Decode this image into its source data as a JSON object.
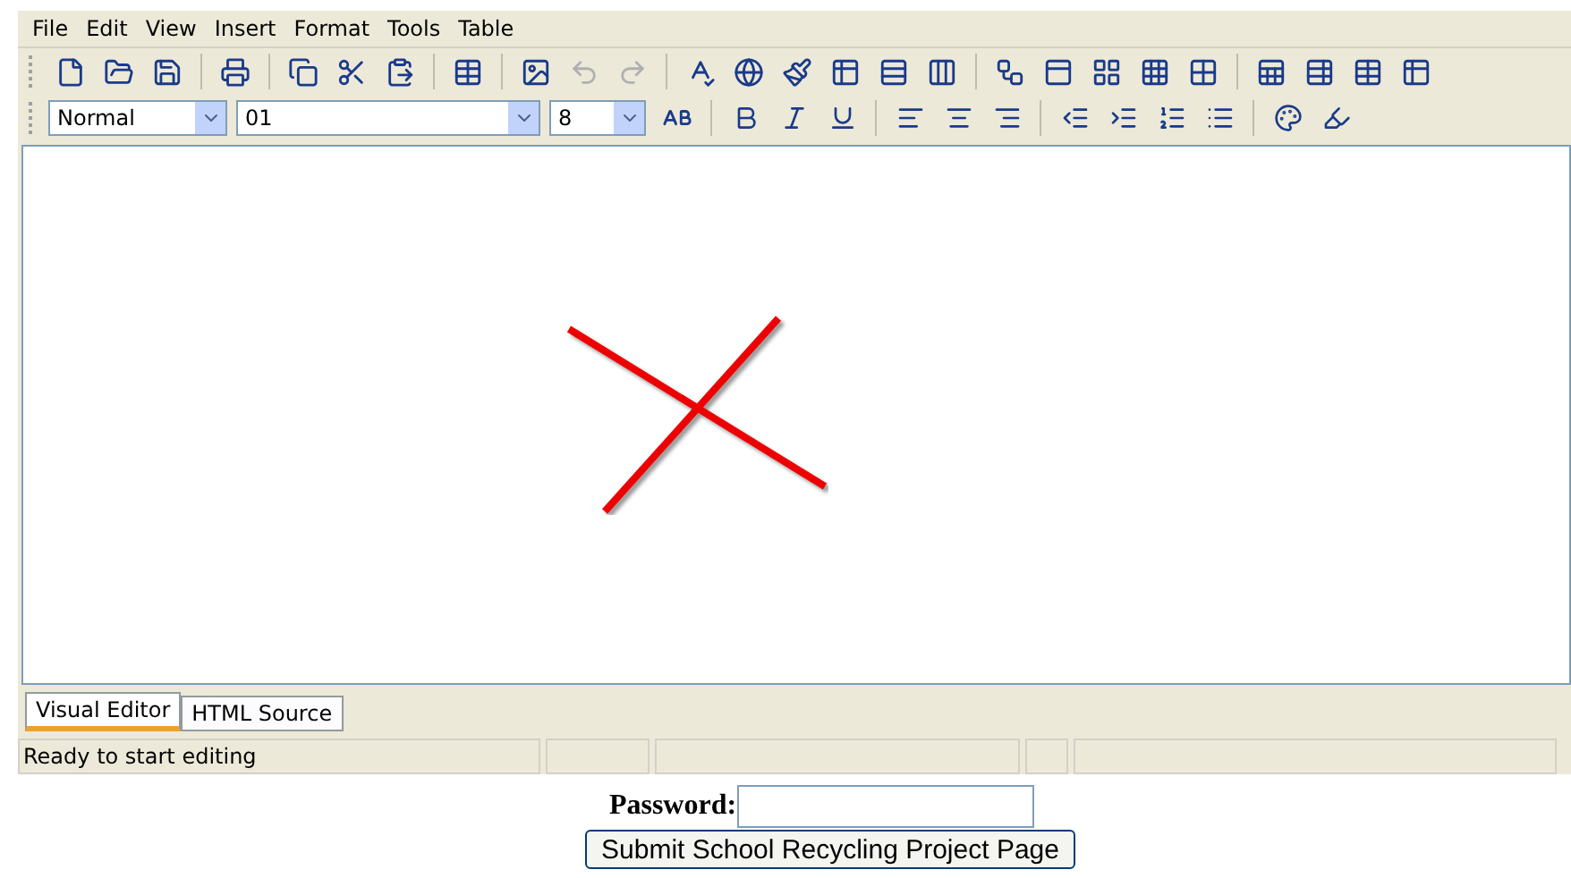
{
  "menu": [
    "File",
    "Edit",
    "View",
    "Insert",
    "Format",
    "Tools",
    "Table"
  ],
  "toolbar_buttons": [
    {
      "disabled": false
    },
    {
      "disabled": false
    },
    {
      "disabled": false
    },
    {
      "disabled": false
    },
    {
      "disabled": false
    },
    {
      "disabled": false
    },
    {
      "disabled": false
    },
    {
      "disabled": false
    },
    {
      "disabled": false
    },
    {
      "disabled": true
    },
    {
      "disabled": true
    },
    {
      "disabled": false
    },
    {
      "disabled": false
    },
    {
      "disabled": false
    },
    {
      "disabled": false
    },
    {
      "disabled": false
    },
    {
      "disabled": false
    },
    {
      "disabled": false
    },
    {
      "disabled": false
    },
    {
      "disabled": false
    },
    {
      "disabled": false
    },
    {
      "disabled": false
    },
    {
      "disabled": false
    },
    {
      "disabled": false
    },
    {
      "disabled": false
    },
    {
      "disabled": false
    }
  ],
  "style_select": "Normal",
  "font_select": "01",
  "size_select": "8",
  "tabs": [
    {
      "label": "Visual Editor",
      "selected": true
    },
    {
      "label": "HTML Source",
      "selected": false
    }
  ],
  "status": [
    "Ready to start editing"
  ],
  "password_label": "Password:",
  "submit": "Submit School Recycling Project Page"
}
